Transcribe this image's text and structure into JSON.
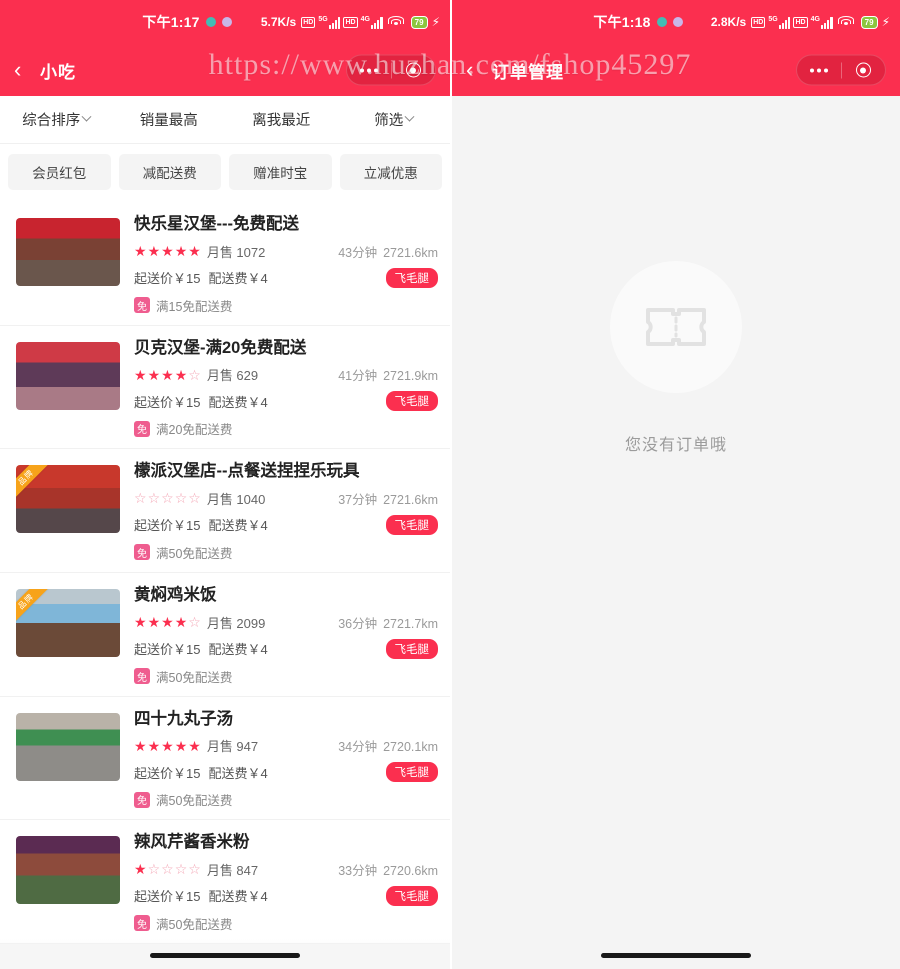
{
  "watermark": "https://www.huzhan.com/fshop45297",
  "colors": {
    "brand_red": "#fb2f4f",
    "badge_pink": "#ef5d8f",
    "ribbon_orange": "#f7a31a",
    "battery_green": "#8cc63f"
  },
  "left_phone": {
    "status_bar": {
      "time": "下午1:17",
      "network_speed": "5.7K/s",
      "hd_label_1": "HD",
      "net_label_1": "5G",
      "hd_label_2": "HD",
      "net_label_2": "4G",
      "battery": "79"
    },
    "nav": {
      "back_icon": "chevron-left-icon",
      "title": "小吃",
      "capsule_more": "more-dots-icon",
      "capsule_target": "target-circle-icon"
    },
    "sort_tabs": [
      {
        "label": "综合排序",
        "has_chevron": true
      },
      {
        "label": "销量最高",
        "has_chevron": false
      },
      {
        "label": "离我最近",
        "has_chevron": false
      },
      {
        "label": "筛选",
        "has_chevron": true
      }
    ],
    "chips": [
      "会员红包",
      "减配送费",
      "赠准时宝",
      "立减优惠"
    ],
    "labels": {
      "min_price_prefix": "起送价￥",
      "delivery_fee_prefix": "配送费￥",
      "free_badge_char": "免",
      "speed_badge": "飞毛腿",
      "ribbon": "品牌"
    },
    "shops": [
      {
        "name": "快乐星汉堡---免费配送",
        "stars_filled": 5,
        "sold": "月售 1072",
        "time": "43分钟",
        "distance": "2721.6km",
        "min_price": "起送价￥15",
        "delivery_fee": "配送费￥4",
        "speed_badge": "飞毛腿",
        "free_text": "满15免配送费",
        "has_ribbon": false,
        "thumb_style": "storefront-red"
      },
      {
        "name": "贝克汉堡-满20免费配送",
        "stars_filled": 4,
        "sold": "月售 629",
        "time": "41分钟",
        "distance": "2721.9km",
        "min_price": "起送价￥15",
        "delivery_fee": "配送费￥4",
        "speed_badge": "飞毛腿",
        "free_text": "满20免配送费",
        "has_ribbon": false,
        "thumb_style": "storefront-pink"
      },
      {
        "name": "檬派汉堡店--点餐送捏捏乐玩具",
        "stars_filled": 0,
        "sold": "月售 1040",
        "time": "37分钟",
        "distance": "2721.6km",
        "min_price": "起送价￥15",
        "delivery_fee": "配送费￥4",
        "speed_badge": "飞毛腿",
        "free_text": "满50免配送费",
        "has_ribbon": true,
        "thumb_style": "storefront-orange"
      },
      {
        "name": "黄焖鸡米饭",
        "stars_filled": 4,
        "sold": "月售 2099",
        "time": "36分钟",
        "distance": "2721.7km",
        "min_price": "起送价￥15",
        "delivery_fee": "配送费￥4",
        "speed_badge": "飞毛腿",
        "free_text": "满50免配送费",
        "has_ribbon": true,
        "thumb_style": "storefront-blue"
      },
      {
        "name": "四十九丸子汤",
        "stars_filled": 5,
        "sold": "月售 947",
        "time": "34分钟",
        "distance": "2720.1km",
        "min_price": "起送价￥15",
        "delivery_fee": "配送费￥4",
        "speed_badge": "飞毛腿",
        "free_text": "满50免配送费",
        "has_ribbon": false,
        "thumb_style": "storefront-green"
      },
      {
        "name": "辣风芹酱香米粉",
        "stars_filled": 1,
        "sold": "月售 847",
        "time": "33分钟",
        "distance": "2720.6km",
        "min_price": "起送价￥15",
        "delivery_fee": "配送费￥4",
        "speed_badge": "飞毛腿",
        "free_text": "满50免配送费",
        "has_ribbon": false,
        "thumb_style": "storefront-purple"
      }
    ]
  },
  "right_phone": {
    "status_bar": {
      "time": "下午1:18",
      "network_speed": "2.8K/s",
      "hd_label_1": "HD",
      "net_label_1": "5G",
      "hd_label_2": "HD",
      "net_label_2": "4G",
      "battery": "79"
    },
    "nav": {
      "back_icon": "chevron-left-icon",
      "title": "订单管理",
      "capsule_more": "more-dots-icon",
      "capsule_target": "target-circle-icon"
    },
    "empty_state": {
      "icon": "ticket-icon",
      "text": "您没有订单哦"
    }
  }
}
